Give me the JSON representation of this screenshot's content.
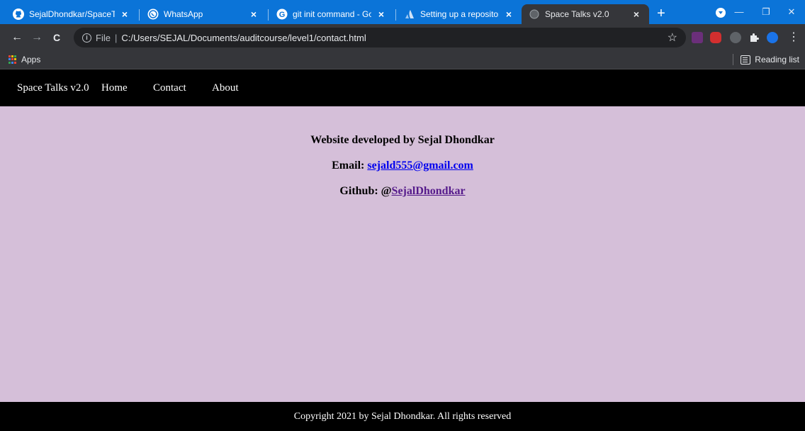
{
  "browser": {
    "tabs": [
      {
        "title": "SejalDhondkar/SpaceTalks",
        "icon": "github-icon",
        "active": false
      },
      {
        "title": "WhatsApp",
        "icon": "whatsapp-icon",
        "active": false
      },
      {
        "title": "git init command - Google",
        "icon": "google-icon",
        "active": false
      },
      {
        "title": "Setting up a repository | A",
        "icon": "atlassian-icon",
        "active": false
      },
      {
        "title": "Space Talks v2.0",
        "icon": "globe-icon",
        "active": true
      }
    ],
    "tab_close": "×",
    "new_tab": "+",
    "window_controls": {
      "minimize": "—",
      "restore": "❐",
      "close": "✕"
    },
    "address": {
      "scheme": "File",
      "path": "C:/Users/SEJAL/Documents/auditcourse/level1/contact.html"
    },
    "nav_glyphs": {
      "back": "←",
      "forward": "→",
      "reload": "C",
      "star": "☆",
      "menu": "⋮"
    },
    "bookmarks": {
      "apps": "Apps",
      "reading_list": "Reading list"
    },
    "colors": {
      "tabbar": "#0b74d8",
      "toolbar": "#35363a",
      "omnibox": "#202124"
    }
  },
  "site": {
    "nav": {
      "brand": "Space Talks v2.0",
      "links": [
        "Home",
        "Contact",
        "About"
      ]
    },
    "contact": {
      "developer_line": "Website developed by Sejal Dhondkar",
      "email_label": "Email: ",
      "email": "sejald555@gmail.com",
      "github_label": "Github: @",
      "github": "SejalDhondkar"
    },
    "footer": "Copyright 2021 by Sejal Dhondkar. All rights reserved",
    "colors": {
      "background": "#d5bfd9",
      "nav": "#000000",
      "link": "#0000ee",
      "visited_link": "#551a8b"
    }
  }
}
